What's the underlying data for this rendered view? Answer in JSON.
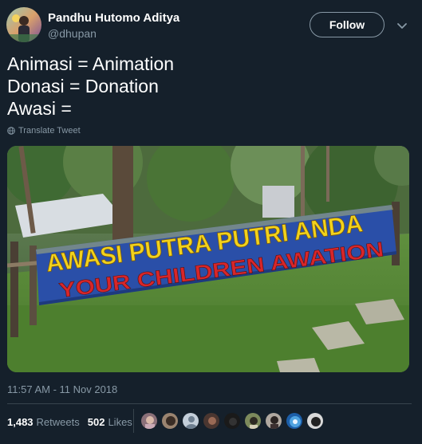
{
  "author": {
    "display_name": "Pandhu Hutomo Aditya",
    "handle": "@dhupan"
  },
  "follow_label": "Follow",
  "tweet_lines": [
    "Animasi = Animation",
    "Donasi = Donation",
    "Awasi ="
  ],
  "translate_label": "Translate Tweet",
  "banner": {
    "line1": "AWASI PUTRA PUTRI ANDA",
    "line2": "YOUR CHILDREN AWATION"
  },
  "timestamp": "11:57 AM - 11 Nov 2018",
  "stats": {
    "retweets_count": "1,483",
    "retweets_label": "Retweets",
    "likes_count": "502",
    "likes_label": "Likes"
  },
  "colors": {
    "background": "#15202b",
    "secondary_text": "#8899a6",
    "divider": "#38444d",
    "banner_blue": "#2a4fa8",
    "banner_yellow": "#f2d21b",
    "banner_red": "#d7262a"
  },
  "icons": [
    "chevron-down-icon",
    "globe-icon"
  ]
}
